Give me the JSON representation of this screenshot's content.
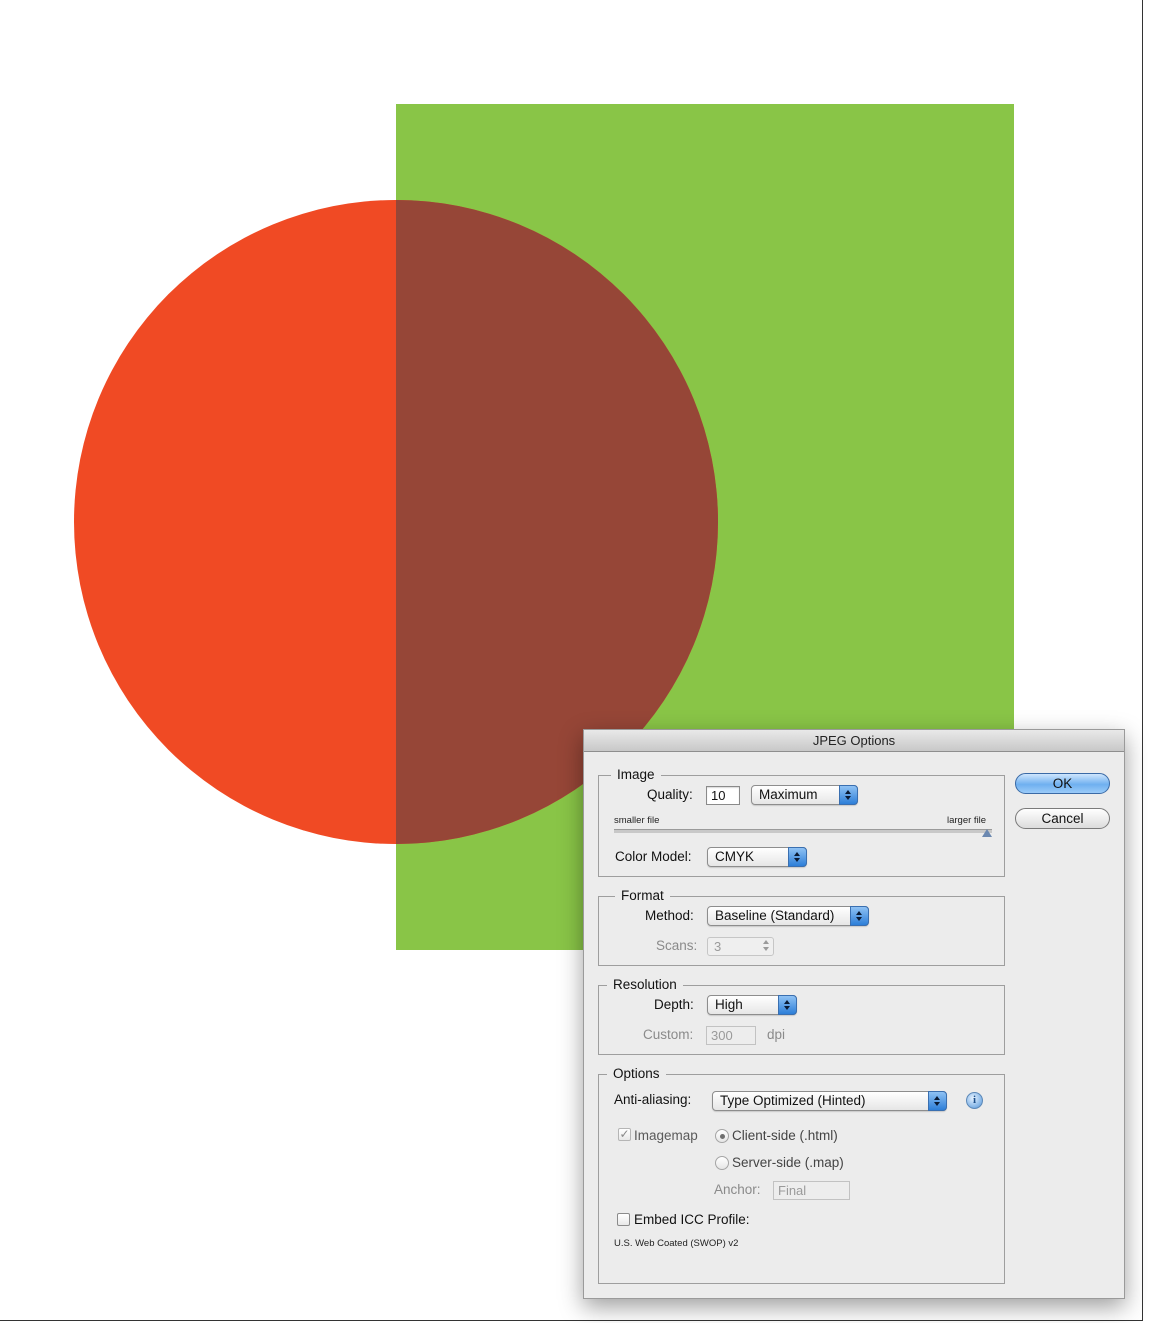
{
  "canvas": {
    "colors": {
      "rect": "#89c547",
      "circle": "#f04a24",
      "overlap": "#964637",
      "background": "#ffffff"
    }
  },
  "dialog": {
    "title": "JPEG Options",
    "buttons": {
      "ok": "OK",
      "cancel": "Cancel"
    },
    "image": {
      "legend": "Image",
      "quality_label": "Quality:",
      "quality_value": "10",
      "quality_preset": "Maximum",
      "smaller_label": "smaller file",
      "larger_label": "larger file",
      "quality_slider_fraction": 1.0,
      "color_model_label": "Color Model:",
      "color_model": "CMYK"
    },
    "format": {
      "legend": "Format",
      "method_label": "Method:",
      "method": "Baseline (Standard)",
      "scans_label": "Scans:",
      "scans": "3"
    },
    "resolution": {
      "legend": "Resolution",
      "depth_label": "Depth:",
      "depth": "High",
      "custom_label": "Custom:",
      "custom_value": "300",
      "custom_unit": "dpi"
    },
    "options": {
      "legend": "Options",
      "antialias_label": "Anti-aliasing:",
      "antialias": "Type Optimized (Hinted)",
      "info_icon": "info-icon",
      "imagemap_label": "Imagemap",
      "imagemap_checked": true,
      "client_side_label": "Client-side (.html)",
      "server_side_label": "Server-side (.map)",
      "selected_map": "client-side",
      "anchor_label": "Anchor:",
      "anchor_value": "Final",
      "embed_icc_label": "Embed ICC Profile:",
      "embed_icc_checked": false,
      "icc_profile": "U.S. Web Coated (SWOP) v2"
    }
  }
}
